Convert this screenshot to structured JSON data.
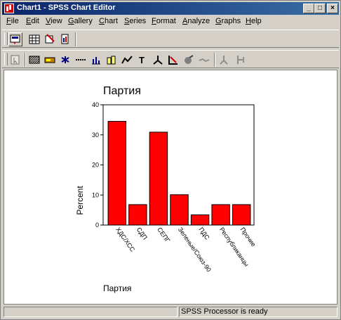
{
  "window": {
    "title": "Chart1 - SPSS Chart Editor"
  },
  "menubar": {
    "items": [
      {
        "key": "F",
        "rest": "ile"
      },
      {
        "key": "E",
        "rest": "dit"
      },
      {
        "key": "V",
        "rest": "iew"
      },
      {
        "key": "G",
        "rest": "allery"
      },
      {
        "key": "C",
        "rest": "hart"
      },
      {
        "key": "S",
        "rest": "eries"
      },
      {
        "key": "F",
        "rest": "ormat"
      },
      {
        "key": "A",
        "rest": "nalyze"
      },
      {
        "key": "G",
        "rest": "raphs"
      },
      {
        "key": "H",
        "rest": "elp"
      }
    ]
  },
  "toolbar1": {
    "buttons": [
      "export-chart-icon",
      "data-grid-icon",
      "swap-axes-icon",
      "chart-properties-icon"
    ]
  },
  "toolbar2": {
    "buttons": [
      "select-icon",
      "fill-pattern-icon",
      "color-icon",
      "marker-icon",
      "line-style-icon",
      "bar-style-icon",
      "bar-label-icon",
      "interpolation-icon",
      "text-icon",
      "three-d-rotation-icon",
      "swap-axes-icon",
      "explode-slice-icon",
      "break-line-icon",
      "spin-mode-icon",
      "point-id-icon"
    ]
  },
  "chart_data": {
    "type": "bar",
    "title": "Партия",
    "xlabel": "Партия",
    "ylabel": "Percent",
    "categories": [
      "ХДС/ХСС",
      "СДП",
      "СЕПГ",
      "Зеленые/Союз-90",
      "ПДС",
      "Республиканцы",
      "Прочие"
    ],
    "values": [
      34.5,
      6.8,
      30.9,
      10.1,
      3.4,
      6.8,
      6.8
    ],
    "ylim": [
      0,
      40
    ],
    "yticks": [
      0,
      10,
      20,
      30,
      40
    ],
    "bar_color": "#ff0000",
    "grid": false
  },
  "status": {
    "message": "SPSS Processor  is ready"
  }
}
